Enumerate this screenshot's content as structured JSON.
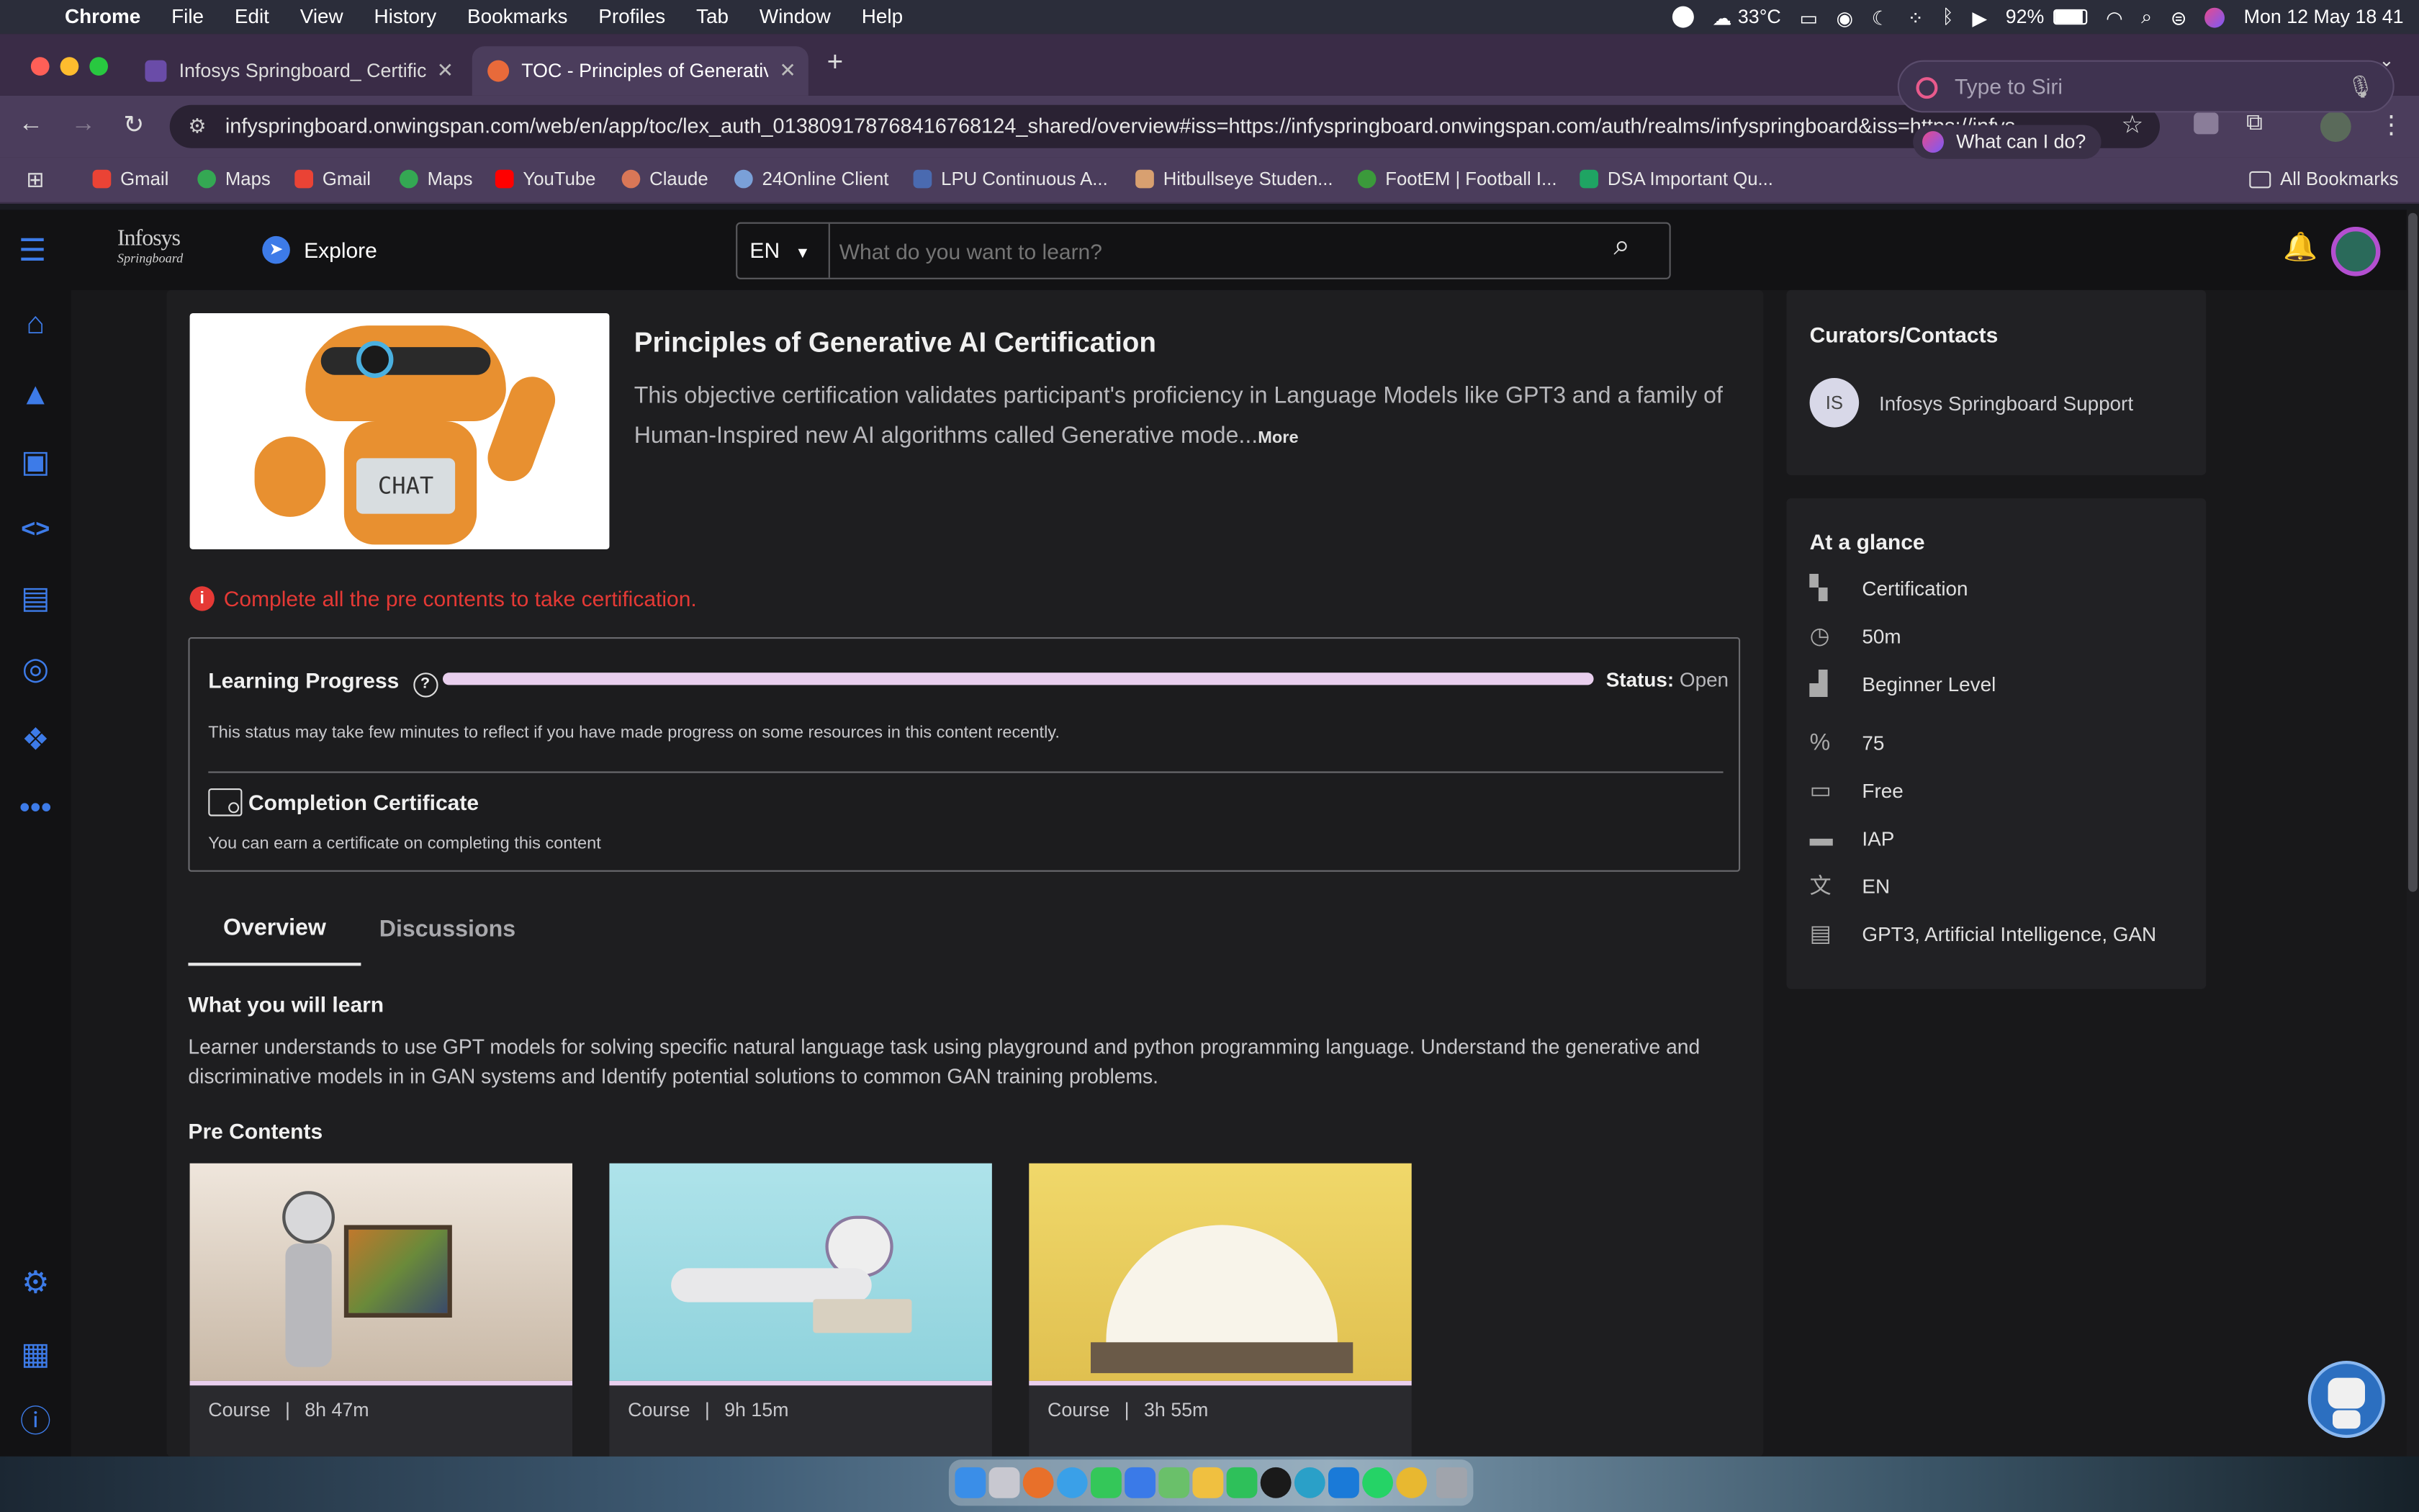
{
  "menubar": {
    "app": "Chrome",
    "items": [
      "File",
      "Edit",
      "View",
      "History",
      "Bookmarks",
      "Profiles",
      "Tab",
      "Window",
      "Help"
    ],
    "weather": "33°C",
    "battery": "92%",
    "datetime": "Mon 12 May  18 41"
  },
  "tabs": [
    {
      "title": "Infosys Springboard_ Certific",
      "active": false
    },
    {
      "title": "TOC - Principles of Generativ",
      "active": true
    }
  ],
  "url": "infyspringboard.onwingspan.com/web/en/app/toc/lex_auth_0138091787684167681​24_shared/overview#iss=https://infyspringboard.onwingspan.com/auth/realms/infyspringboard&iss=https://infys",
  "bookmarks": [
    "Gmail",
    "Maps",
    "Gmail",
    "Maps",
    "YouTube",
    "Claude",
    "24Online Client",
    "LPU Continuous A...",
    "Hitbullseye Studen...",
    "FootEM | Football I...",
    "DSA Important Qu..."
  ],
  "all_bookmarks": "All Bookmarks",
  "siri": {
    "placeholder": "Type to Siri",
    "hint": "What can I do?"
  },
  "header": {
    "logo_line1": "Infosys",
    "logo_line2": "Springboard",
    "explore": "Explore",
    "lang": "EN",
    "search_placeholder": "What do you want to learn?"
  },
  "course": {
    "title": "Principles of Generative AI Certification",
    "description": "This objective certification validates participant's proficiency in Language Models like GPT3 and a family of Human-Inspired new AI algorithms called Generative mode...",
    "more": "More",
    "thumb_text": "CHAT",
    "warning": "Complete all the pre contents to take certification."
  },
  "progress": {
    "label": "Learning Progress",
    "value": 1.0,
    "status_label": "Status:",
    "status_value": "Open",
    "note": "This status may take few minutes to reflect if you have made progress on some resources in this content recently.",
    "cert_title": "Completion Certificate",
    "cert_note": "You can earn a certificate on completing this content"
  },
  "tabs_content": {
    "overview": "Overview",
    "discussions": "Discussions"
  },
  "learn": {
    "heading": "What you will learn",
    "text": "Learner understands to use GPT models for solving specific natural language task using playground and python programming language. Understand the generative and discriminative models in in GAN systems and Identify potential solutions to common GAN training problems."
  },
  "pre_contents": {
    "heading": "Pre Contents",
    "items": [
      {
        "type": "Course",
        "duration": "8h 47m"
      },
      {
        "type": "Course",
        "duration": "9h 15m"
      },
      {
        "type": "Course",
        "duration": "3h 55m"
      }
    ]
  },
  "curators": {
    "heading": "Curators/Contacts",
    "initials": "IS",
    "name": "Infosys Springboard Support"
  },
  "glance": {
    "heading": "At a glance",
    "rows": [
      {
        "icon": "certification-icon",
        "text": "Certification"
      },
      {
        "icon": "clock-icon",
        "text": "50m"
      },
      {
        "icon": "bar-chart-icon",
        "text": "Beginner Level"
      },
      {
        "icon": "percent-icon",
        "text": "75"
      },
      {
        "icon": "card-icon",
        "text": "Free"
      },
      {
        "icon": "folder-icon",
        "text": "IAP"
      },
      {
        "icon": "translate-icon",
        "text": "EN"
      },
      {
        "icon": "document-icon",
        "text": "GPT3, Artificial Intelligence, GAN"
      }
    ]
  },
  "colors": {
    "accent": "#3d7be8",
    "warning": "#e53935",
    "progress": "#e9cfee"
  }
}
